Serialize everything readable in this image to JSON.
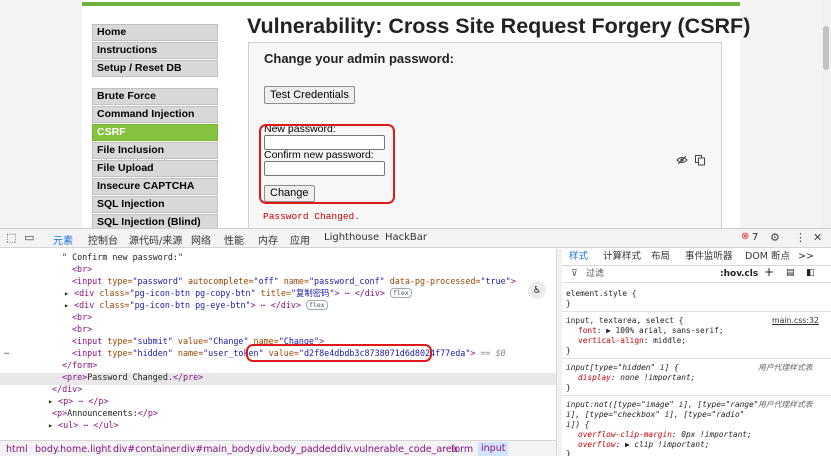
{
  "page": {
    "title": "Vulnerability: Cross Site Request Forgery (CSRF)",
    "menu": [
      {
        "label": "Home",
        "active": false
      },
      {
        "label": "Instructions",
        "active": false
      },
      {
        "label": "Setup / Reset DB",
        "active": false
      },
      {
        "label": "Brute Force",
        "active": false
      },
      {
        "label": "Command Injection",
        "active": false
      },
      {
        "label": "CSRF",
        "active": true
      },
      {
        "label": "File Inclusion",
        "active": false
      },
      {
        "label": "File Upload",
        "active": false
      },
      {
        "label": "Insecure CAPTCHA",
        "active": false
      },
      {
        "label": "SQL Injection",
        "active": false
      },
      {
        "label": "SQL Injection (Blind)",
        "active": false
      }
    ],
    "heading": "Change your admin password:",
    "test_button": "Test Credentials",
    "new_password_label": "New password:",
    "confirm_password_label": "Confirm new password:",
    "change_button": "Change",
    "message": "Password Changed.",
    "accent_color": "#86c33f",
    "highlight_color": "#e0191b"
  },
  "devtools": {
    "tabs": [
      "元素",
      "控制台",
      "源代码/来源",
      "网络",
      "性能",
      "内存",
      "应用",
      "Lighthouse",
      "HackBar"
    ],
    "active_tab": "元素",
    "error_count": "7",
    "dom_lines": {
      "l1": "\" Confirm new password:\"",
      "l2": "<br>",
      "l3_tag": "<input ",
      "l3_a1": "type=",
      "l3_v1": "\"password\"",
      "l3_a2": " autocomplete=",
      "l3_v2": "\"off\"",
      "l3_a3": " name=",
      "l3_v3": "\"password_conf\"",
      "l3_a4": " data-pg-processed=",
      "l3_v4": "\"true\"",
      "l3_end": ">",
      "l4_tag": "<div ",
      "l4_a1": "class=",
      "l4_v1": "\"pg-icon-btn pg-copy-btn\"",
      "l4_a2": " title=",
      "l4_v2": "\"复制密码\"",
      "l4_end": "> ⋯ </div>",
      "l4_pill": "flex",
      "l5_tag": "<div ",
      "l5_a1": "class=",
      "l5_v1": "\"pg-icon-btn pg-eye-btn\"",
      "l5_end": "> ⋯ </div>",
      "l5_pill": "flex",
      "l6": "<br>",
      "l7": "<br>",
      "l8_tag": "<input ",
      "l8_a1": "type=",
      "l8_v1": "\"submit\"",
      "l8_a2": " value=",
      "l8_v2": "\"Change\"",
      "l8_a3": " name=",
      "l8_v3": "\"Change\"",
      "l8_end": ">",
      "l9_tag": "<input ",
      "l9_a1": "type=",
      "l9_v1": "\"hidden\"",
      "l9_a2": " name=",
      "l9_v2": "\"user_token\"",
      "l9_a3": " value=",
      "l9_v3": "\"d2f8e4dbdb3c8738071d6d8024f77eda\"",
      "l9_end": ">",
      "l9_eq": " == $0",
      "l10": "</form>",
      "l11_open": "<pre>",
      "l11_txt": "Password Changed.",
      "l11_close": "</pre>",
      "l12": "</div>",
      "l13": "<p> ⋯ </p>",
      "l14_open": "<p>",
      "l14_txt": "Announcements:",
      "l14_close": "</p>",
      "l15": "<ul> ⋯ </ul>"
    },
    "breadcrumb": [
      "html",
      "body.home.light",
      "div#container",
      "div#main_body",
      "div.body_padded",
      "div.vulnerable_code_area",
      "form",
      "input"
    ],
    "styles_tabs": [
      "样式",
      "计算样式",
      "布局",
      "事件监听器",
      "DOM 断点",
      ">>"
    ],
    "filter_placeholder": "过滤",
    "filter_hov": ":hov",
    "filter_cls": ".cls",
    "styles": {
      "r1_sel": "element.style {",
      "r1_end": "}",
      "r2_sel": "input, textarea, select {",
      "r2_link": "main.css:32",
      "r2_p1": "font",
      "r2_v1": ": ▶ 100% arial, sans-serif;",
      "r2_p2": "vertical-align",
      "r2_v2": ": middle;",
      "r2_end": "}",
      "r3_sel": "input[type=\"hidden\" i] {",
      "r3_ua": "用户代理样式表",
      "r3_p1": "display",
      "r3_v1": ": none !important;",
      "r3_end": "}",
      "r4_sel1": "input:not([type=\"image\" i], [type=\"range\"",
      "r4_sel2": "i], [type=\"checkbox\" i], [type=\"radio\"",
      "r4_sel3": "i]) {",
      "r4_ua": "用户代理样式表",
      "r4_p1": "overflow-clip-margin",
      "r4_v1": ": 0px !important;",
      "r4_p2": "overflow",
      "r4_v2": ": ▶ clip !important;",
      "r4_end": "}"
    }
  }
}
